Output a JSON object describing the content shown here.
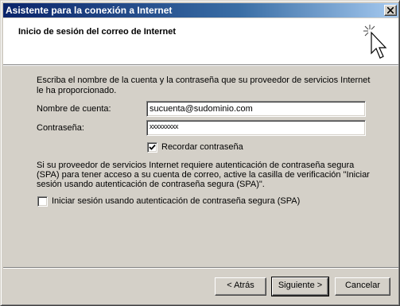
{
  "window": {
    "title": "Asistente para la conexión a Internet"
  },
  "header": {
    "title": "Inicio de sesión del correo de Internet",
    "icon": "wizard-cursor-icon"
  },
  "intro": {
    "line1": "Escriba el nombre de la cuenta y la contraseña que su proveedor de servicios Internet",
    "line2": "le ha proporcionado."
  },
  "account": {
    "label": "Nombre de cuenta:",
    "value": "sucuenta@sudominio.com"
  },
  "password": {
    "label": "Contraseña:",
    "masked": "xxxxxxxxx"
  },
  "remember": {
    "label": "Recordar contraseña",
    "checked": true
  },
  "spa_info": {
    "line1": "Si su proveedor de servicios Internet requiere autenticación de contraseña segura",
    "line2": "(SPA) para tener acceso a su cuenta de correo, active la casilla de verificación \"Iniciar",
    "line3": "sesión usando autenticación de contraseña segura (SPA)\"."
  },
  "spa": {
    "label": "Iniciar sesión usando autenticación de contraseña segura (SPA)",
    "checked": false
  },
  "buttons": {
    "back": "< Atrás",
    "next": "Siguiente >",
    "cancel": "Cancelar"
  },
  "colors": {
    "title_gradient_start": "#0a246a",
    "title_gradient_end": "#a6caf0",
    "face": "#d4d0c8"
  }
}
